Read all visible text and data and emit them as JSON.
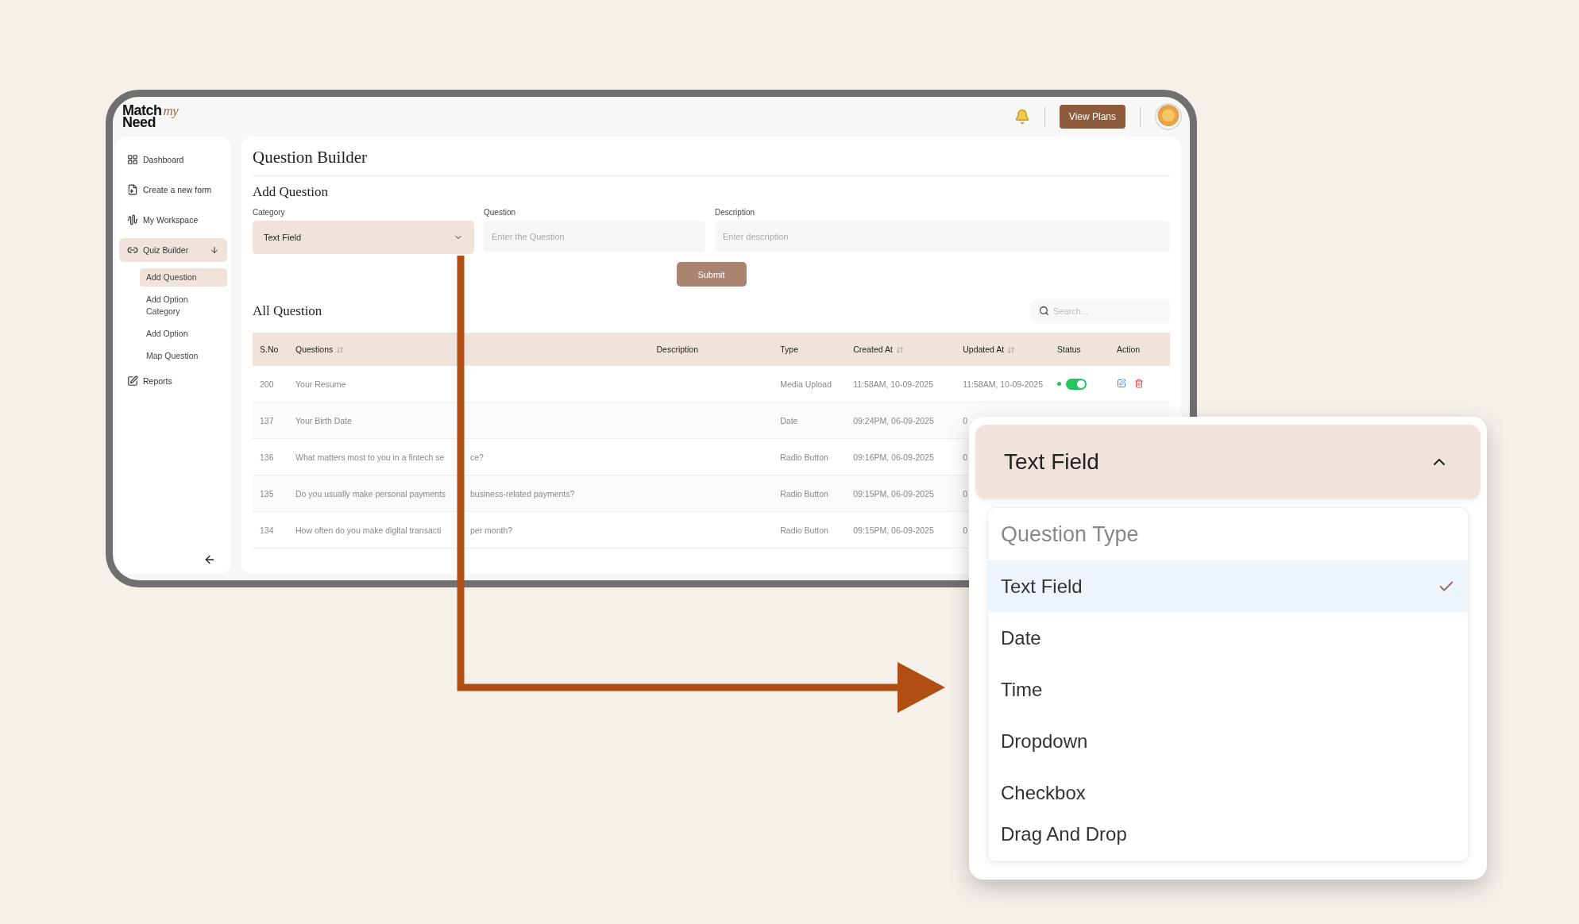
{
  "header": {
    "logo": {
      "line1": "Match",
      "accent": "my",
      "line2": "Need"
    },
    "button": "View Plans"
  },
  "sidebar": {
    "items": [
      {
        "label": "Dashboard",
        "selected": false
      },
      {
        "label": "Create a new form",
        "selected": false
      },
      {
        "label": "My Workspace",
        "selected": false
      },
      {
        "label": "Quiz Builder",
        "selected": true,
        "expanded": true,
        "children": [
          {
            "label": "Add Question",
            "selected": true
          },
          {
            "label": "Add Option Category",
            "selected": false
          },
          {
            "label": "Add Option",
            "selected": false
          },
          {
            "label": "Map Question",
            "selected": false
          }
        ]
      },
      {
        "label": "Reports",
        "selected": false
      }
    ]
  },
  "page": {
    "title": "Question Builder",
    "form_title": "Add Question",
    "fields": [
      {
        "label": "Category",
        "value": "Text Field",
        "kind": "select"
      },
      {
        "label": "Question",
        "placeholder": "Enter the Question",
        "kind": "text"
      },
      {
        "label": "Description",
        "placeholder": "Enter description",
        "kind": "text"
      }
    ],
    "submit": "Submit",
    "list_title": "All Question",
    "search": {
      "placeholder": "Search..."
    }
  },
  "table": {
    "columns": [
      {
        "label": "S.No",
        "sortable": false
      },
      {
        "label": "Questions",
        "sortable": true
      },
      {
        "label": "Description",
        "sortable": false
      },
      {
        "label": "Type",
        "sortable": false
      },
      {
        "label": "Created At",
        "sortable": true
      },
      {
        "label": "Updated At",
        "sortable": true
      },
      {
        "label": "Status",
        "sortable": false
      },
      {
        "label": "Action",
        "sortable": false
      }
    ],
    "rows": [
      {
        "sno": "200",
        "question": [
          "Your Resume"
        ],
        "type": "Media Upload",
        "created": "11:58AM, 10-09-2025",
        "updated": "11:58AM, 10-09-2025",
        "active": true
      },
      {
        "sno": "137",
        "question": [
          "Your Birth Date"
        ],
        "type": "Date",
        "created": "09:24PM, 06-09-2025",
        "updated": "0"
      },
      {
        "sno": "136",
        "question": [
          "What matters most to you in a fintech se",
          "ce?"
        ],
        "type": "Radio Button",
        "created": "09:16PM, 06-09-2025",
        "updated": "0"
      },
      {
        "sno": "135",
        "question": [
          "Do you usually make personal payments",
          "business-related payments?"
        ],
        "type": "Radio Button",
        "created": "09:15PM, 06-09-2025",
        "updated": "0"
      },
      {
        "sno": "134",
        "question": [
          "How often do you make digital transacti",
          "per month?"
        ],
        "type": "Radio Button",
        "created": "09:15PM, 06-09-2025",
        "updated": "0"
      }
    ]
  },
  "zoom_dropdown": {
    "value": "Text Field",
    "expanded": true,
    "header": "Question Type",
    "options": [
      {
        "label": "Text Field",
        "selected": true
      },
      {
        "label": "Date",
        "selected": false
      },
      {
        "label": "Time",
        "selected": false
      },
      {
        "label": "Dropdown",
        "selected": false
      },
      {
        "label": "Checkbox",
        "selected": false
      },
      {
        "label": "Drag And Drop",
        "selected": false
      }
    ]
  }
}
